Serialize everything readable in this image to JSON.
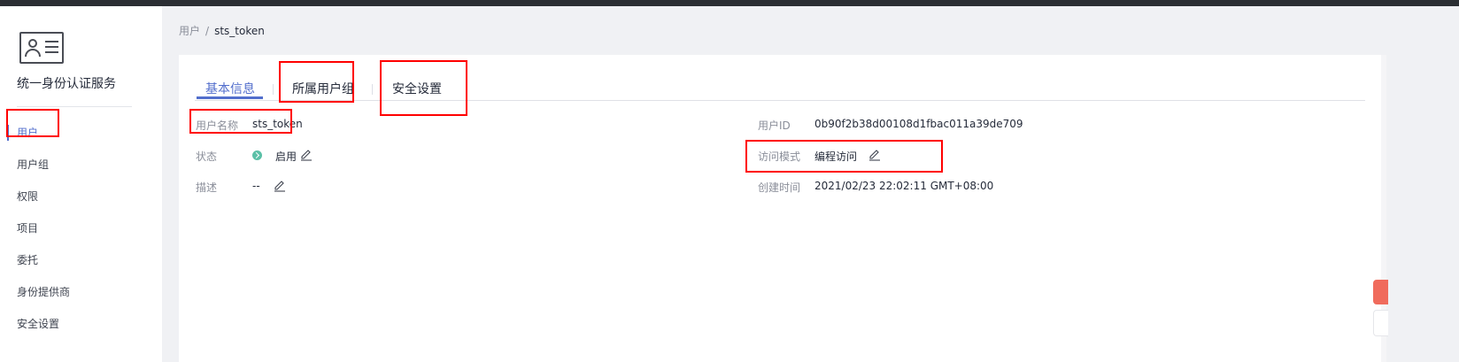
{
  "sidebar": {
    "service_icon": "user-card-icon",
    "title": "统一身份认证服务",
    "items": [
      {
        "label": "用户"
      },
      {
        "label": "用户组"
      },
      {
        "label": "权限"
      },
      {
        "label": "项目"
      },
      {
        "label": "委托"
      },
      {
        "label": "身份提供商"
      },
      {
        "label": "安全设置"
      }
    ],
    "active_index": 0
  },
  "breadcrumb": {
    "parent": "用户",
    "separator": "/",
    "current": "sts_token"
  },
  "tabs": [
    {
      "label": "基本信息"
    },
    {
      "label": "所属用户组"
    },
    {
      "label": "安全设置"
    }
  ],
  "info": {
    "username_label": "用户名称",
    "username_value": "sts_token",
    "status_label": "状态",
    "status_value": "启用",
    "description_label": "描述",
    "description_value": "--",
    "user_id_label": "用户ID",
    "user_id_value": "0b90f2b38d00108d1fbac011a39de709",
    "access_mode_label": "访问模式",
    "access_mode_value": "编程访问",
    "created_label": "创建时间",
    "created_value": "2021/02/23 22:02:11 GMT+08:00"
  },
  "colors": {
    "accent": "#526ecc",
    "status_ok": "#5bc0a7",
    "annotation": "#ff0000"
  }
}
